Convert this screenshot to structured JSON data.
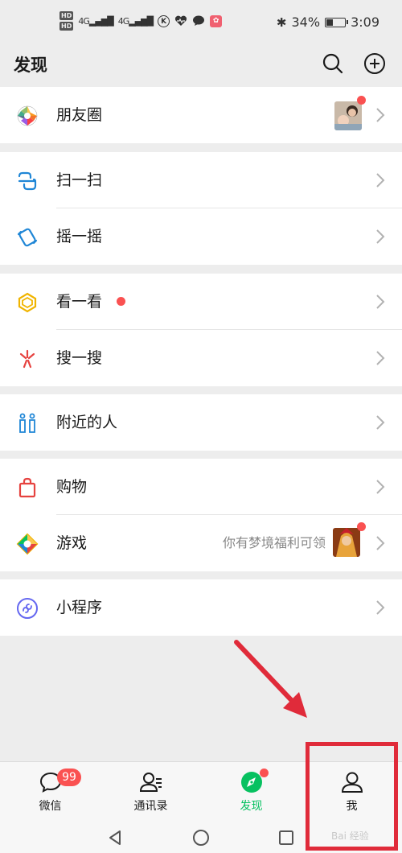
{
  "status_bar": {
    "hd1": "HD",
    "hd2": "HD",
    "signal1": "4G",
    "signal2": "4G",
    "app_k": "K",
    "battery_text": "34%",
    "battery_level": 0.34,
    "time": "3:09"
  },
  "header": {
    "title": "发现"
  },
  "items": {
    "moments": "朋友圈",
    "scan": "扫一扫",
    "shake": "摇一摇",
    "top_stories": "看一看",
    "search": "搜一搜",
    "nearby": "附近的人",
    "shopping": "购物",
    "games": "游戏",
    "games_note": "你有梦境福利可领",
    "mini_programs": "小程序"
  },
  "tabs": {
    "chats": "微信",
    "chats_badge": "99",
    "contacts": "通讯录",
    "discover": "发现",
    "me": "我"
  },
  "watermark": "Bai 经验",
  "colors": {
    "accent": "#07c160",
    "red_dot": "#fa5151",
    "annotation": "#e02b3a"
  }
}
